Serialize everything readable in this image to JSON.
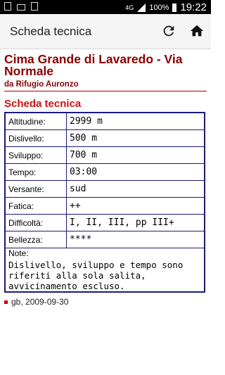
{
  "status_bar": {
    "network": "4G",
    "battery": "100%",
    "time": "19:22"
  },
  "app_bar": {
    "title": "Scheda tecnica"
  },
  "route": {
    "title": "Cima Grande di Lavaredo - Via Normale",
    "subtitle": "da Rifugio Auronzo"
  },
  "section_title": "Scheda tecnica",
  "specs": [
    {
      "label": "Altitudine:",
      "value": "2999 m"
    },
    {
      "label": "Dislivello:",
      "value": "500 m"
    },
    {
      "label": "Sviluppo:",
      "value": "700 m"
    },
    {
      "label": "Tempo:",
      "value": "03:00"
    },
    {
      "label": "Versante:",
      "value": "sud"
    },
    {
      "label": "Fatica:",
      "value": "++"
    },
    {
      "label": "Difficoltà:",
      "value": "I, II, III, pp III+"
    },
    {
      "label": "Bellezza:",
      "value": "****"
    }
  ],
  "note": {
    "label": "Note:",
    "text": "Dislivello, sviluppo e tempo sono riferiti alla sola salita, avvicinamento escluso."
  },
  "footer": {
    "text": "gb, 2009-09-30"
  },
  "colors": {
    "title_red": "#8b0000",
    "section_red": "#cc1111",
    "table_border": "#1a1a7a"
  }
}
